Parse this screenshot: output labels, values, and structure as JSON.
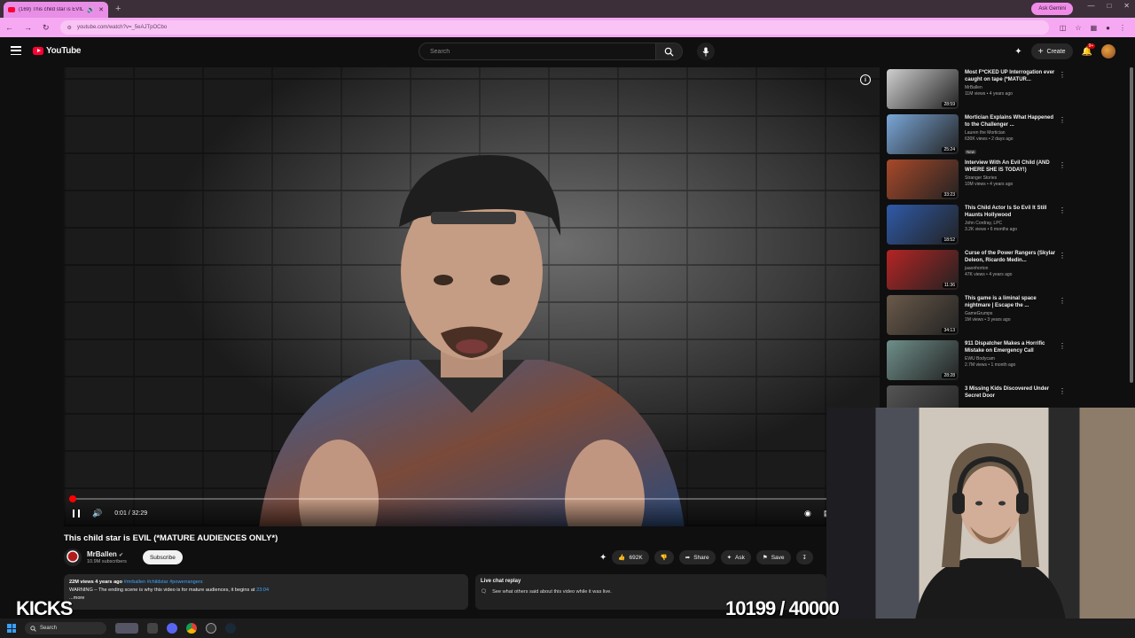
{
  "browser": {
    "tab_title": "(169) This child star is EVIL (*M...",
    "url": "youtube.com/watch?v=_5eAJTpOCbo",
    "ask_gemini": "Ask Gemini"
  },
  "header": {
    "logo_text": "YouTube",
    "search_placeholder": "Search",
    "create_label": "Create",
    "notif_count": "9+"
  },
  "player": {
    "current_time": "0:01",
    "duration": "32:29",
    "progress_fraction": 0.004
  },
  "video": {
    "title": "This child star is EVIL (*MATURE AUDIENCES ONLY*)",
    "channel": "MrBallen",
    "subscribers": "10.9M subscribers",
    "subscribe_label": "Subscribe",
    "likes": "692K",
    "share_label": "Share",
    "ask_label": "Ask",
    "save_label": "Save",
    "desc_meta": "22M views  4 years ago",
    "desc_tags": "#mrballen #childstar #powerrangers",
    "desc_line": "WARNING – The ending scene is why this video is for mature audiences, it begins at",
    "desc_link": "23:04",
    "desc_more": "...more"
  },
  "chat": {
    "title": "Live chat replay",
    "subtitle": "See what others said about this video while it was live."
  },
  "recommendations": [
    {
      "title": "Most F*CKED UP Interrogation ever caught on tape (*MATUR...",
      "channel": "MrBallen",
      "meta": "11M views • 4 years ago",
      "duration": "28:59",
      "color": "#cfcfcf"
    },
    {
      "title": "Mortician Explains What Happened to the Challenger ...",
      "channel": "Lauren the Mortician",
      "meta": "630K views • 2 days ago",
      "duration": "25:24",
      "new": "New",
      "color": "#7aa7d8"
    },
    {
      "title": "Interview With An Evil Child (AND WHERE SHE IS TODAY!)",
      "channel": "Stranger Stories",
      "meta": "10M views • 4 years ago",
      "duration": "33:23",
      "color": "#a8492a"
    },
    {
      "title": "This Child Actor Is So Evil It Still Haunts Hollywood",
      "channel": "John Cordray, LPC",
      "meta": "3.2K views • 6 months ago",
      "duration": "18:52",
      "color": "#2f5aa8"
    },
    {
      "title": "Curse of the Power Rangers (Skylar Deleon, Ricardo Medin...",
      "channel": "jaaonhorton",
      "meta": "47K views • 4 years ago",
      "duration": "11:36",
      "color": "#b52424"
    },
    {
      "title": "This game is a liminal space nightmare | Escape the ...",
      "channel": "GameGrumps",
      "meta": "1M views • 3 years ago",
      "duration": "34:13",
      "color": "#6a5a4a"
    },
    {
      "title": "911 Dispatcher Makes a Horrific Mistake on Emergency Call",
      "channel": "EWU Bodycam",
      "meta": "2.7M views • 1 month ago",
      "duration": "28:28",
      "color": "#6f8f8a"
    },
    {
      "title": "3 Missing Kids Discovered Under Secret Door",
      "channel": "",
      "meta": "",
      "duration": "",
      "color": "#555555"
    }
  ],
  "overlay": {
    "kicks_label": "KICKS",
    "counter": "10199 / 40000"
  },
  "taskbar": {
    "search_label": "Search"
  }
}
